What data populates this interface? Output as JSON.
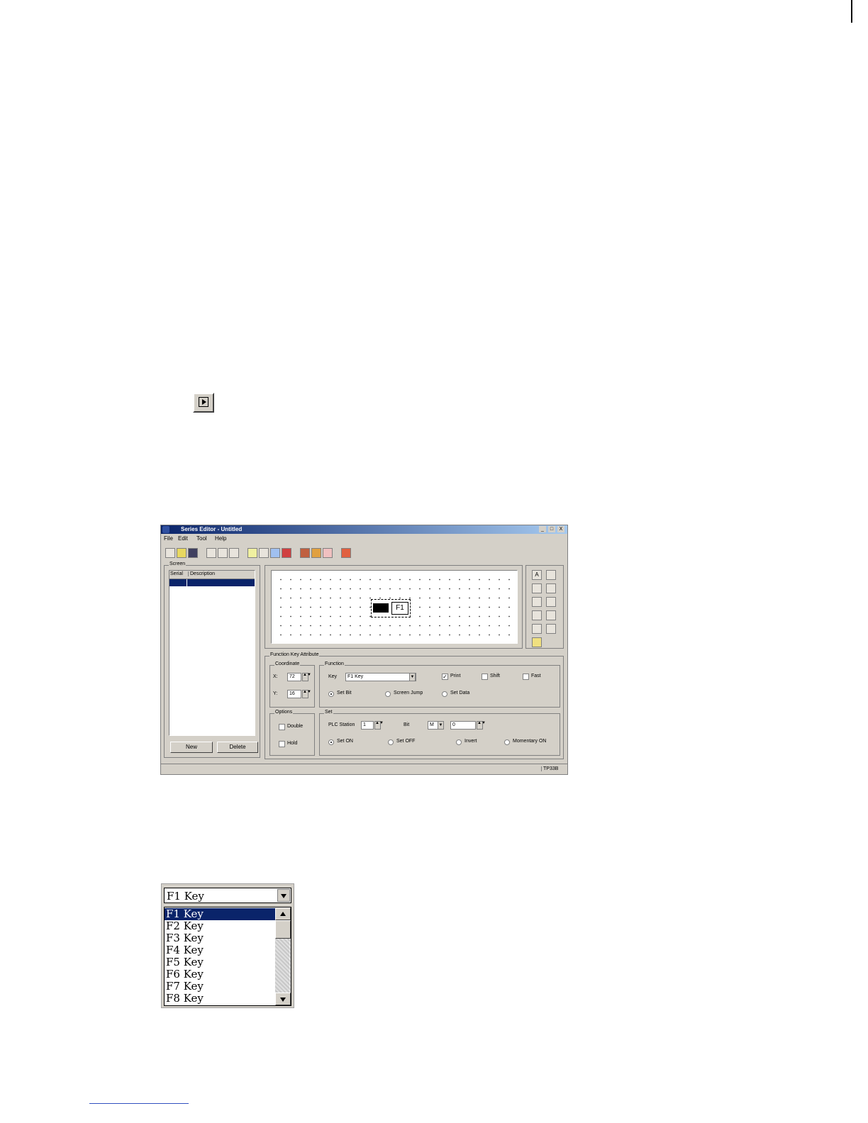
{
  "window": {
    "title": "Series Editor - Untitled",
    "minimize": "_",
    "maximize": "□",
    "close": "X"
  },
  "menu": [
    "File",
    "Edit",
    "Tool",
    "Help"
  ],
  "screen_panel": {
    "label": "Screen",
    "col_serial": "Serial",
    "col_description": "Description",
    "new_button": "New",
    "delete_button": "Delete"
  },
  "canvas": {
    "key_label": "F1"
  },
  "function_key_attribute": {
    "label": "Function Key Attribute",
    "coordinate": {
      "label": "Coordinate",
      "x_label": "X:",
      "x_value": "72",
      "y_label": "Y:",
      "y_value": "16"
    },
    "function": {
      "label": "Function",
      "key_label": "Key",
      "key_value": "F1 Key",
      "print_label": "Print",
      "shift_label": "Shift",
      "fast_label": "Fast",
      "set_bit_label": "Set Bit",
      "screen_jump_label": "Screen Jump",
      "set_data_label": "Set Data"
    },
    "options": {
      "label": "Options",
      "double_label": "Double",
      "hold_label": "Hold"
    },
    "set": {
      "label": "Set",
      "plc_station_label": "PLC Station",
      "plc_station_value": "1",
      "bit_label": "Bit",
      "bit_type": "M",
      "bit_value": "0",
      "mode1_label": "Set ON",
      "mode2_label": "Set OFF",
      "mode3_label": "Invert",
      "mode4_label": "Momentary ON"
    }
  },
  "status": {
    "model": "TP33B"
  },
  "dropdown": {
    "selected": "F1 Key",
    "items": [
      "F1 Key",
      "F2 Key",
      "F3 Key",
      "F4 Key",
      "F5 Key",
      "F6 Key",
      "F7 Key",
      "F8 Key"
    ]
  },
  "colors": {
    "title_bar": "#0a246a",
    "selection": "#0a246a",
    "window_face": "#d4d0c8"
  }
}
